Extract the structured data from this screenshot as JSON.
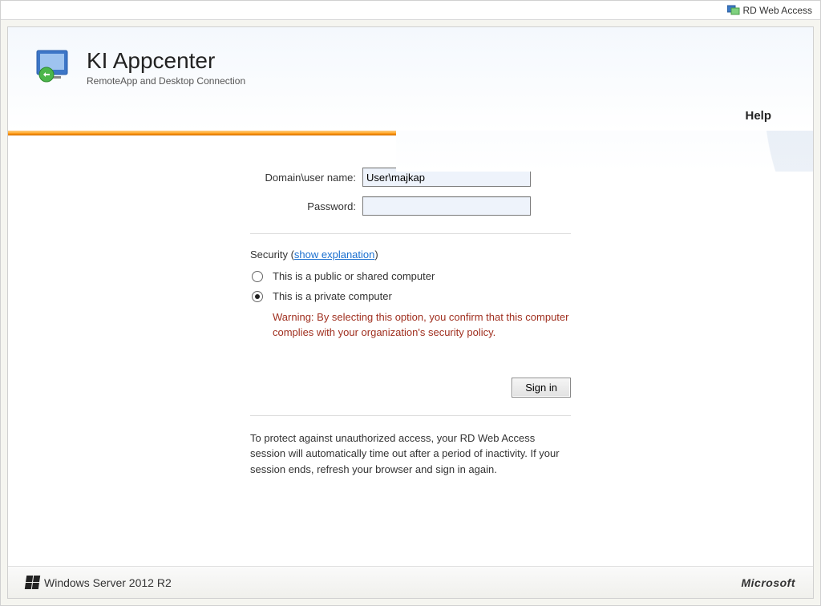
{
  "topbar": {
    "label": "RD Web Access"
  },
  "brand": {
    "title": "KI Appcenter",
    "subtitle": "RemoteApp and Desktop Connection"
  },
  "nav": {
    "help": "Help"
  },
  "form": {
    "username_label": "Domain\\user name:",
    "username_value": "User\\majkap",
    "password_label": "Password:",
    "password_value": ""
  },
  "security": {
    "heading_prefix": "Security (",
    "link": "show explanation",
    "heading_suffix": ")",
    "option_public": "This is a public or shared computer",
    "option_private": "This is a private computer",
    "selected": "private",
    "warning": "Warning: By selecting this option, you confirm that this computer complies with your organization's security policy."
  },
  "actions": {
    "signin": "Sign in"
  },
  "notice": "To protect against unauthorized access, your RD Web Access session will automatically time out after a period of inactivity. If your session ends, refresh your browser and sign in again.",
  "footer": {
    "left": "Windows Server 2012 R2",
    "right": "Microsoft"
  }
}
